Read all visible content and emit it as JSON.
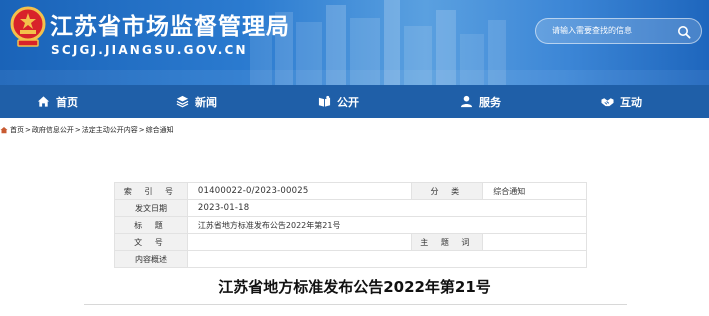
{
  "header": {
    "title": "江苏省市场监督管理局",
    "domain": "SCJGJ.JIANGSU.GOV.CN",
    "search_placeholder": "请输入需要查找的信息"
  },
  "nav": {
    "items": [
      {
        "label": "首页",
        "icon": "home-icon"
      },
      {
        "label": "新闻",
        "icon": "layers-icon"
      },
      {
        "label": "公开",
        "icon": "open-book-icon"
      },
      {
        "label": "服务",
        "icon": "user-icon"
      },
      {
        "label": "互动",
        "icon": "handshake-icon"
      }
    ]
  },
  "breadcrumb": {
    "items": [
      "首页",
      "政府信息公开",
      "法定主动公开内容",
      "综合通知"
    ],
    "separator": ">"
  },
  "meta": {
    "index_label": "索 引 号",
    "index_value": "01400022-0/2023-00025",
    "category_label": "分 类",
    "category_value": "综合通知",
    "date_label": "发文日期",
    "date_value": "2023-01-18",
    "title_label": "标 题",
    "title_value": "江苏省地方标准发布公告2022年第21号",
    "doc_no_label": "文 号",
    "doc_no_value": "",
    "subject_label": "主 题 词",
    "subject_value": "",
    "summary_label": "内容概述",
    "summary_value": ""
  },
  "document": {
    "title": "江苏省地方标准发布公告2022年第21号"
  },
  "colors": {
    "nav_bg": "#1f5fa8",
    "header_bg": "#2b7bd0",
    "table_label_bg": "#f1f1f1"
  }
}
